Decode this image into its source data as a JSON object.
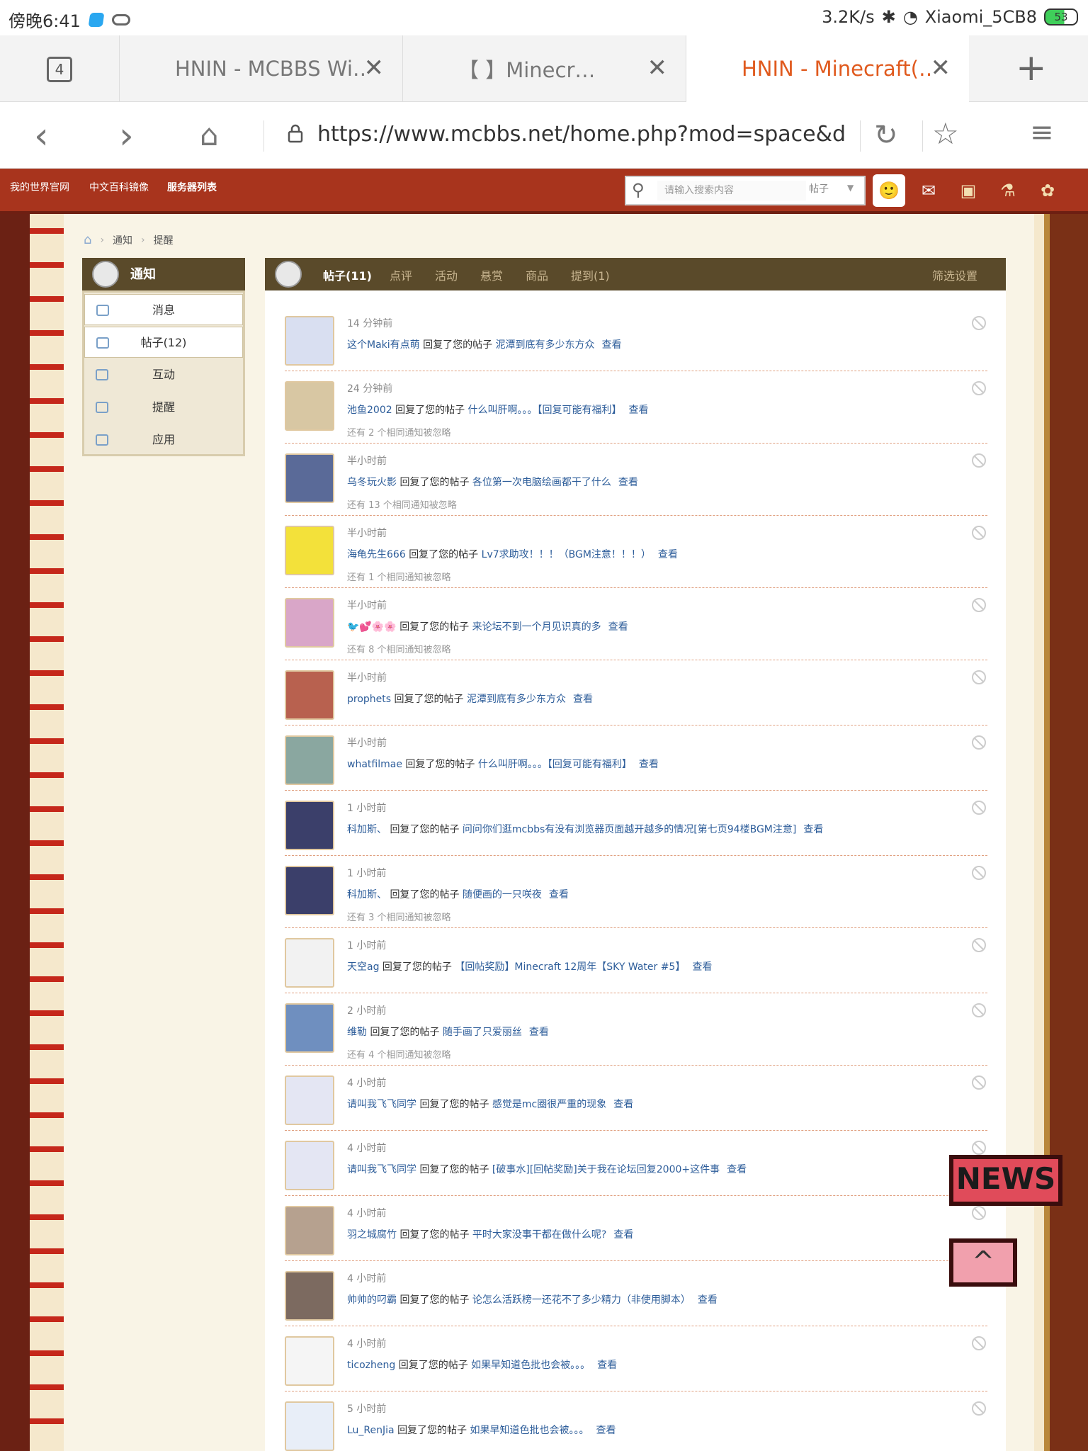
{
  "status": {
    "time": "傍晚6:41",
    "speed": "3.2K/s",
    "wifi": "Xiaomi_5CB8",
    "battery": "53"
  },
  "browser": {
    "tab_count": "4",
    "tabs": [
      {
        "title": "HNIN - MCBBS Wi…"
      },
      {
        "title": "【         】Minecr…"
      },
      {
        "title": "HNIN - Minecraft(…"
      }
    ],
    "url": "https://www.mcbbs.net/home.php?mod=space&do=notice&"
  },
  "site": {
    "nav": [
      "我的世界官网",
      "中文百科镜像",
      "服务器列表"
    ],
    "search_placeholder": "请输入搜索内容",
    "search_scope": "帖子",
    "breadcrumb": [
      "通知",
      "提醒"
    ],
    "left_title": "通知",
    "left_menu": [
      "消息",
      "帖子(12)",
      "互动",
      "提醒",
      "应用"
    ],
    "tabs": [
      "帖子(11)",
      "点评",
      "活动",
      "悬赏",
      "商品",
      "提到(1)"
    ],
    "filter": "筛选设置",
    "replied": "回复了您的帖子",
    "view": "查看",
    "notices": [
      {
        "time": "14 分钟前",
        "user": "这个Maki有点萌",
        "post": "泥潭到底有多少东方众",
        "ignored": "",
        "bg": "#d9dff1"
      },
      {
        "time": "24 分钟前",
        "user": "池鱼2002",
        "post": "什么叫肝啊。。。【回复可能有福利】",
        "ignored": "还有 2 个相同通知被忽略",
        "bg": "#d8c7a3"
      },
      {
        "time": "半小时前",
        "user": "乌冬玩火影",
        "post": "各位第一次电脑绘画都干了什么",
        "ignored": "还有 13 个相同通知被忽略",
        "bg": "#5a6a98"
      },
      {
        "time": "半小时前",
        "user": "海龟先生666",
        "post": "Lv7求助攻！！！（BGM注意！！！）",
        "ignored": "还有 1 个相同通知被忽略",
        "bg": "#f3e13a"
      },
      {
        "time": "半小时前",
        "user": "🐦💕🌸🌸",
        "post": "来论坛不到一个月见识真的多",
        "ignored": "还有 8 个相同通知被忽略",
        "bg": "#d9a6c8"
      },
      {
        "time": "半小时前",
        "user": "prophets",
        "post": "泥潭到底有多少东方众",
        "ignored": "",
        "bg": "#b8614f"
      },
      {
        "time": "半小时前",
        "user": "whatfilmae",
        "post": "什么叫肝啊。。。【回复可能有福利】",
        "ignored": "",
        "bg": "#8aa7a0"
      },
      {
        "time": "1 小时前",
        "user": "科加斯、",
        "post": "问问你们逛mcbbs有没有浏览器页面越开越多的情况[第七页94楼BGM注意]",
        "ignored": "",
        "bg": "#3b3f6a"
      },
      {
        "time": "1 小时前",
        "user": "科加斯、",
        "post": "随便画的一只咲夜",
        "ignored": "还有 3 个相同通知被忽略",
        "bg": "#3b3f6a"
      },
      {
        "time": "1 小时前",
        "user": "天空ag",
        "post": "【回帖奖励】Minecraft 12周年【SKY Water #5】",
        "ignored": "",
        "bg": "#f2f2f2"
      },
      {
        "time": "2 小时前",
        "user": "维勒",
        "post": "随手画了只爱丽丝",
        "ignored": "还有 4 个相同通知被忽略",
        "bg": "#6f8fbf"
      },
      {
        "time": "4 小时前",
        "user": "请叫我飞飞同学",
        "post": "感觉是mc圈很严重的现象",
        "ignored": "",
        "bg": "#e4e6f3"
      },
      {
        "time": "4 小时前",
        "user": "请叫我飞飞同学",
        "post": "[破事水][回帖奖励]关于我在论坛回复2000+这件事",
        "ignored": "",
        "bg": "#e4e6f3"
      },
      {
        "time": "4 小时前",
        "user": "羽之城腐竹",
        "post": "平时大家没事干都在做什么呢?",
        "ignored": "",
        "bg": "#b6a18f"
      },
      {
        "time": "4 小时前",
        "user": "帅帅的叼霸",
        "post": "论怎么活跃榜一还花不了多少精力（非使用脚本）",
        "ignored": "",
        "bg": "#7c6a60"
      },
      {
        "time": "4 小时前",
        "user": "ticozheng",
        "post": "如果早知道色批也会被。。。",
        "ignored": "",
        "bg": "#f5f5f5"
      },
      {
        "time": "5 小时前",
        "user": "Lu_RenJia",
        "post": "如果早知道色批也会被。。。",
        "ignored": "",
        "bg": "#e8eef8"
      }
    ],
    "news_label": "NEWS",
    "up_label": "^"
  }
}
